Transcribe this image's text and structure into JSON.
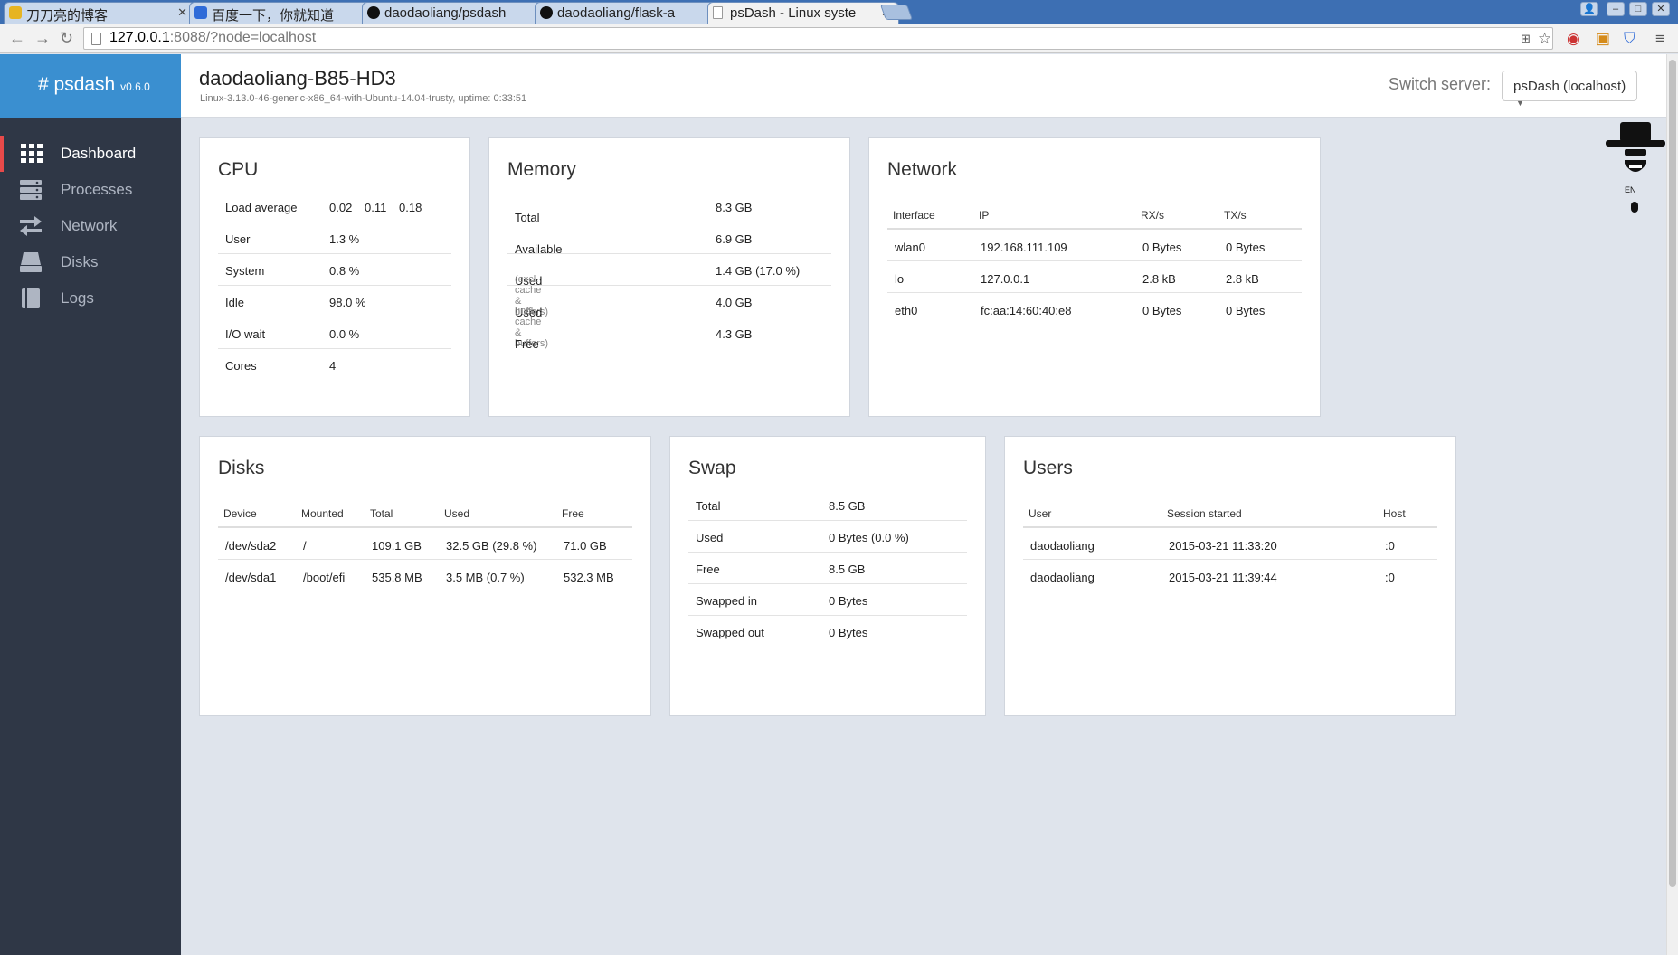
{
  "browser": {
    "tabs": [
      {
        "title": "刀刀亮的博客",
        "favicon_color": "#e6b422"
      },
      {
        "title": "百度一下，你就知道",
        "favicon_color": "#2f6bd8"
      },
      {
        "title": "daodaoliang/psdash",
        "favicon_color": "#111111"
      },
      {
        "title": "daodaoliang/flask-a",
        "favicon_color": "#111111"
      },
      {
        "title": "psDash - Linux syste",
        "favicon_color": "#ffffff"
      }
    ],
    "url_host": "127.0.0.1",
    "url_rest": ":8088/?node=localhost"
  },
  "brand": {
    "name": "# psdash",
    "version": "v0.6.0"
  },
  "sidebar": {
    "items": [
      {
        "label": "Dashboard",
        "icon": "grid-icon"
      },
      {
        "label": "Processes",
        "icon": "server-list-icon"
      },
      {
        "label": "Network",
        "icon": "exchange-arrows-icon"
      },
      {
        "label": "Disks",
        "icon": "drive-icon"
      },
      {
        "label": "Logs",
        "icon": "book-icon"
      }
    ]
  },
  "header": {
    "hostname": "daodaoliang-B85-HD3",
    "sysinfo": "Linux-3.13.0-46-generic-x86_64-with-Ubuntu-14.04-trusty, uptime: 0:33:51",
    "switch_label": "Switch server:",
    "server_value": "psDash (localhost)"
  },
  "cpu": {
    "title": "CPU",
    "load_label": "Load average",
    "load": [
      "0.02",
      "0.11",
      "0.18"
    ],
    "rows": [
      {
        "label": "User",
        "value": "1.3 %"
      },
      {
        "label": "System",
        "value": "0.8 %"
      },
      {
        "label": "Idle",
        "value": "98.0 %"
      },
      {
        "label": "I/O wait",
        "value": "0.0 %"
      },
      {
        "label": "Cores",
        "value": "4"
      }
    ]
  },
  "memory": {
    "title": "Memory",
    "rows": [
      {
        "label": "Total",
        "note": "",
        "value": "8.3 GB"
      },
      {
        "label": "Available",
        "note": "",
        "value": "6.9 GB"
      },
      {
        "label": "Used",
        "note": "(excl. cache & buffers)",
        "value": "1.4 GB (17.0 %)"
      },
      {
        "label": "Used",
        "note": "(incl. cache & buffers)",
        "value": "4.0 GB"
      },
      {
        "label": "Free",
        "note": "",
        "value": "4.3 GB"
      }
    ]
  },
  "network": {
    "title": "Network",
    "headers": [
      "Interface",
      "IP",
      "RX/s",
      "TX/s"
    ],
    "rows": [
      [
        "wlan0",
        "192.168.111.109",
        "0 Bytes",
        "0 Bytes"
      ],
      [
        "lo",
        "127.0.0.1",
        "2.8 kB",
        "2.8 kB"
      ],
      [
        "eth0",
        "fc:aa:14:60:40:e8",
        "0 Bytes",
        "0 Bytes"
      ]
    ]
  },
  "disks": {
    "title": "Disks",
    "headers": [
      "Device",
      "Mounted",
      "Total",
      "Used",
      "Free"
    ],
    "rows": [
      [
        "/dev/sda2",
        "/",
        "109.1 GB",
        "32.5 GB (29.8 %)",
        "71.0 GB"
      ],
      [
        "/dev/sda1",
        "/boot/efi",
        "535.8 MB",
        "3.5 MB (0.7 %)",
        "532.3 MB"
      ]
    ]
  },
  "swap": {
    "title": "Swap",
    "rows": [
      {
        "label": "Total",
        "value": "8.5 GB"
      },
      {
        "label": "Used",
        "value": "0 Bytes (0.0 %)"
      },
      {
        "label": "Free",
        "value": "8.5 GB"
      },
      {
        "label": "Swapped in",
        "value": "0 Bytes"
      },
      {
        "label": "Swapped out",
        "value": "0 Bytes"
      }
    ]
  },
  "users": {
    "title": "Users",
    "headers": [
      "User",
      "Session started",
      "Host"
    ],
    "rows": [
      [
        "daodaoliang",
        "2015-03-21 11:33:20",
        ":0"
      ],
      [
        "daodaoliang",
        "2015-03-21 11:39:44",
        ":0"
      ]
    ]
  },
  "extension": {
    "label": "EN"
  },
  "colors": {
    "brand": "#3a8fd0",
    "sidebar": "#2f3746",
    "active_marker": "#e84a4a",
    "background": "#dfe4ec"
  }
}
